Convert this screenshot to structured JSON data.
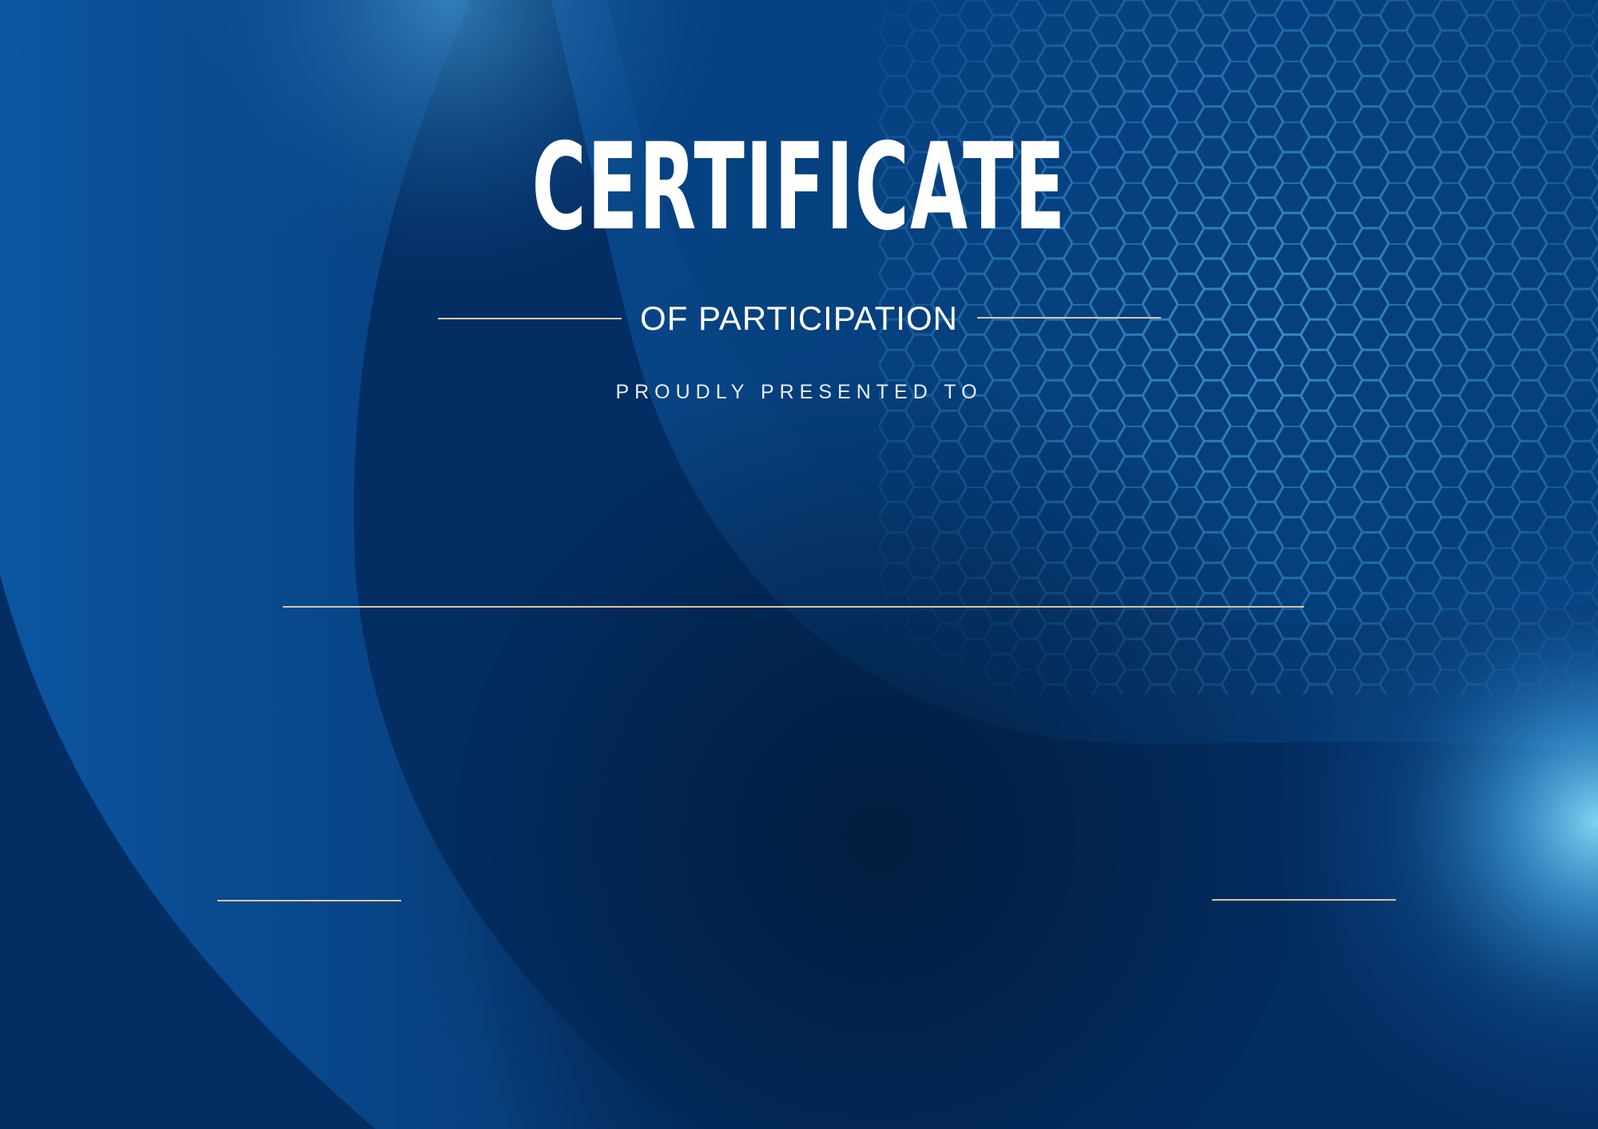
{
  "certificate": {
    "title": "CERTIFICATE",
    "subtitle": "OF PARTICIPATION",
    "presented_to": "PROUDLY PRESENTED TO"
  },
  "colors": {
    "background_dark": "#022a5c",
    "background_accent": "#0a5aa8",
    "glow": "#5fc0e8",
    "hex_pattern": "#3aa0d8",
    "gold_rule": "#d8c89c",
    "text": "#ffffff"
  }
}
